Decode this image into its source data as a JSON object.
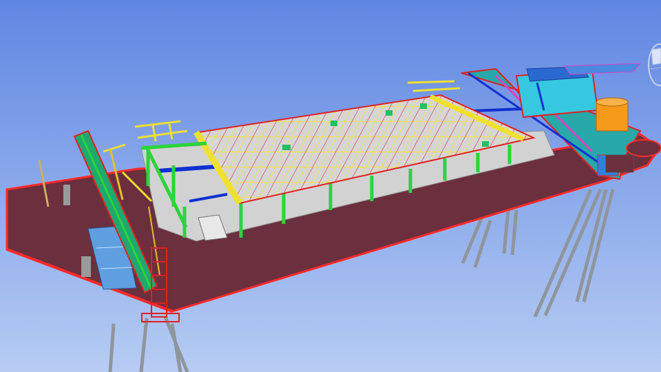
{
  "viewport": {
    "background_top": "#5f86e2",
    "background_bottom": "#b6ccf3"
  },
  "colors": {
    "deck_fill": "#6b2f3e",
    "deck_edge": "#ff2a2a",
    "column": "#2bd43a",
    "beam_yellow": "#f0e030",
    "beam_red": "#e02020",
    "beam_blue": "#1030d0",
    "slab_grey": "#c9c9c9",
    "pile_grey": "#8f959c",
    "cyan": "#35c8e0",
    "tank_orange": "#f59a1a",
    "magenta": "#e040c0"
  },
  "icons": {
    "navigation": "viewcube-icon"
  }
}
